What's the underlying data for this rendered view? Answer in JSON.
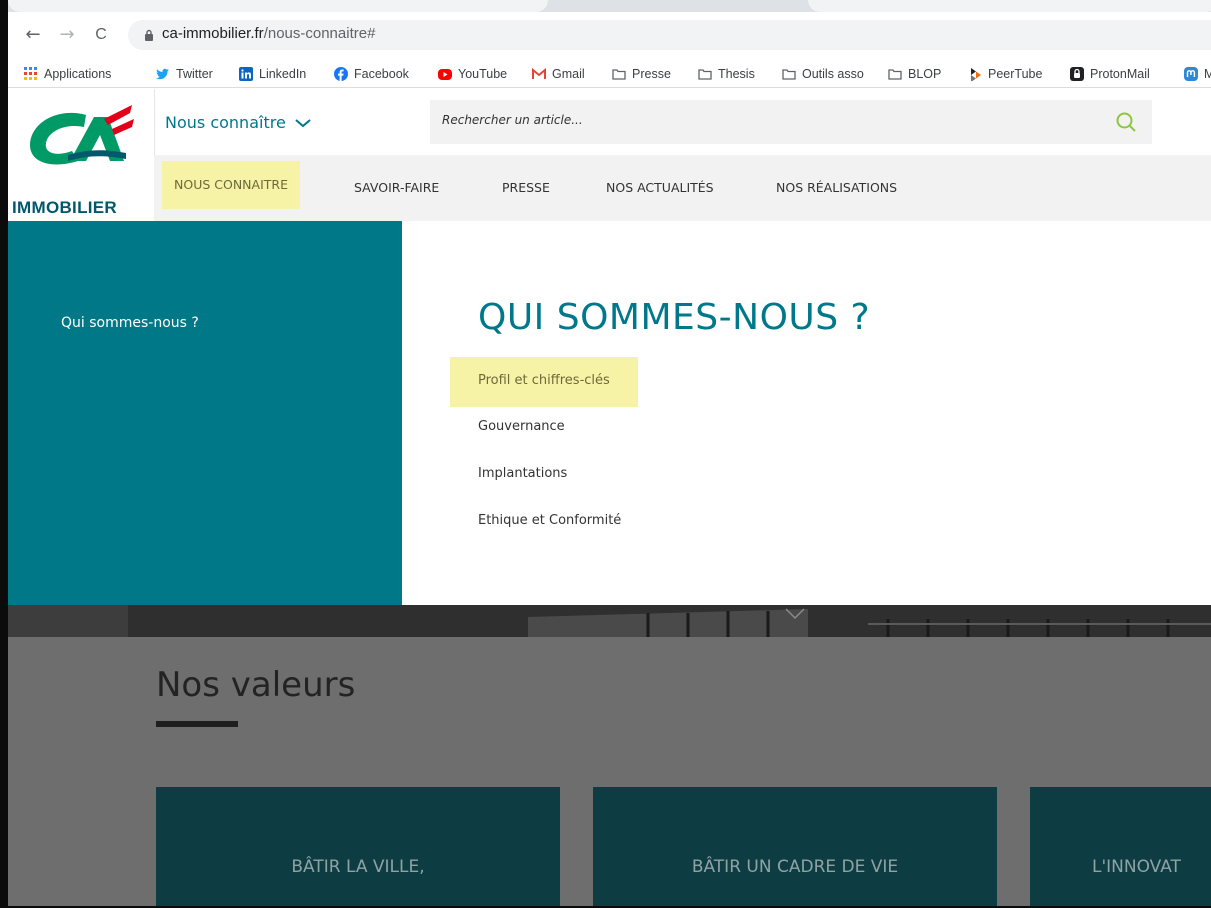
{
  "browser": {
    "nav_back": "←",
    "nav_forward": "→",
    "nav_reload": "C",
    "url_domain": "ca-immobilier.fr",
    "url_path": "/nous-connaitre#",
    "bookmarks": [
      {
        "label": "Applications",
        "icon": "apps-grid-icon",
        "color": "#4285f4"
      },
      {
        "label": "Twitter",
        "icon": "twitter-icon",
        "color": "#1da1f2"
      },
      {
        "label": "LinkedIn",
        "icon": "linkedin-icon",
        "color": "#0a66c2"
      },
      {
        "label": "Facebook",
        "icon": "facebook-icon",
        "color": "#1877f2"
      },
      {
        "label": "YouTube",
        "icon": "youtube-icon",
        "color": "#ff0000"
      },
      {
        "label": "Gmail",
        "icon": "gmail-icon",
        "color": "#ea4335"
      },
      {
        "label": "Presse",
        "icon": "folder-icon",
        "color": "#5f6368"
      },
      {
        "label": "Thesis",
        "icon": "folder-icon",
        "color": "#5f6368"
      },
      {
        "label": "Outils asso",
        "icon": "folder-icon",
        "color": "#5f6368"
      },
      {
        "label": "BLOP",
        "icon": "folder-icon",
        "color": "#5f6368"
      },
      {
        "label": "PeerTube",
        "icon": "peertube-icon",
        "color": "#f1680d"
      },
      {
        "label": "ProtonMail",
        "icon": "protonmail-icon",
        "color": "#202124"
      },
      {
        "label": "M",
        "icon": "mastodon-icon",
        "color": "#3088d4"
      }
    ]
  },
  "header": {
    "logo_text": "IMMOBILIER",
    "section_dropdown": "Nous connaître",
    "search_placeholder": "Rechercher un article...",
    "nav": [
      {
        "label": "NOUS CONNAITRE",
        "active": true
      },
      {
        "label": "SAVOIR-FAIRE",
        "active": false
      },
      {
        "label": "PRESSE",
        "active": false
      },
      {
        "label": "NOS ACTUALITÉS",
        "active": false
      },
      {
        "label": "NOS RÉALISATIONS",
        "active": false
      }
    ]
  },
  "megamenu": {
    "left_item": "Qui sommes-nous ?",
    "title": "QUI SOMMES-NOUS ?",
    "links": [
      {
        "label": "Profil et chiffres-clés",
        "active": true
      },
      {
        "label": "Gouvernance",
        "active": false
      },
      {
        "label": "Implantations",
        "active": false
      },
      {
        "label": "Ethique et Conformité",
        "active": false
      }
    ]
  },
  "page": {
    "values_title": "Nos valeurs",
    "cards": [
      {
        "title": "BÂTIR LA VILLE,"
      },
      {
        "title": "BÂTIR UN CADRE DE VIE"
      },
      {
        "title": "L'INNOVAT"
      }
    ]
  },
  "colors": {
    "brand_teal": "#007888",
    "highlight_yellow": "#f6f2a6",
    "logo_red": "#e2001a",
    "logo_green": "#009a66"
  }
}
